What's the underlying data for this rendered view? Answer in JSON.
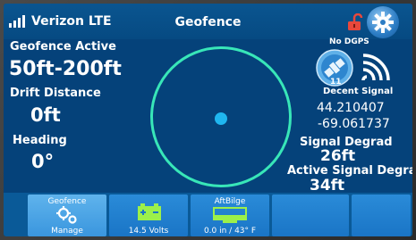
{
  "status_bar": {
    "carrier": "Verizon LTE",
    "title": "Geofence"
  },
  "left_panel": {
    "geofence_label": "Geofence Active",
    "geofence_range": "50ft-200ft",
    "drift_label": "Drift Distance",
    "drift_value": "0ft",
    "heading_label": "Heading",
    "heading_value": "0°"
  },
  "right_panel": {
    "dgps_status": "No DGPS",
    "satellite_count": "11",
    "signal_status": "Decent Signal",
    "latitude": "44.210407",
    "longitude": "-69.061737",
    "signal_degrad_label": "Signal Degrad",
    "signal_degrad_value": "26ft",
    "active_signal_degrad_label": "Active Signal Degrad",
    "active_signal_degrad_value": "34ft"
  },
  "bottom_tabs": [
    {
      "top_label": "Geofence",
      "bottom_label": "Manage",
      "icon": "gears-icon",
      "active": true
    },
    {
      "top_label": "",
      "bottom_label": "14.5 Volts",
      "icon": "battery-icon",
      "active": false
    },
    {
      "top_label": "AftBilge",
      "bottom_label": "0.0 in / 43° F",
      "icon": "bilge-tank-icon",
      "active": false
    },
    {
      "top_label": "",
      "bottom_label": "",
      "icon": "",
      "active": false
    },
    {
      "top_label": "",
      "bottom_label": "",
      "icon": "",
      "active": false
    }
  ],
  "colors": {
    "screen_bg": "#05427a",
    "ring": "#38e6b8",
    "position_dot": "#1fb6f0",
    "lock_icon": "#e8483c",
    "tab_bg": "#1a75c6",
    "tab_active_bg": "#3a96de"
  }
}
